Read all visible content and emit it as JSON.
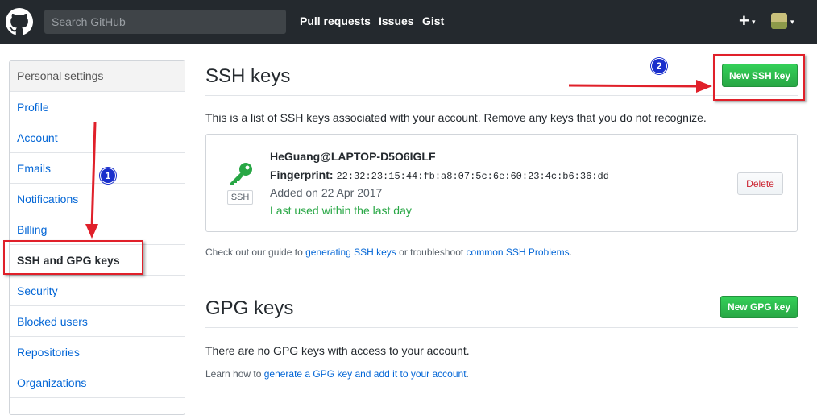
{
  "header": {
    "search_placeholder": "Search GitHub",
    "nav": [
      "Pull requests",
      "Issues",
      "Gist"
    ],
    "plus_label": "+",
    "caret": "▾"
  },
  "sidebar": {
    "heading": "Personal settings",
    "items": [
      {
        "label": "Profile"
      },
      {
        "label": "Account"
      },
      {
        "label": "Emails"
      },
      {
        "label": "Notifications"
      },
      {
        "label": "Billing"
      },
      {
        "label": "SSH and GPG keys",
        "selected": true
      },
      {
        "label": "Security"
      },
      {
        "label": "Blocked users"
      },
      {
        "label": "Repositories"
      },
      {
        "label": "Organizations"
      }
    ]
  },
  "ssh": {
    "title": "SSH keys",
    "new_button": "New SSH key",
    "description": "This is a list of SSH keys associated with your account. Remove any keys that you do not recognize.",
    "key": {
      "name": "HeGuang@LAPTOP-D5O6IGLF",
      "fingerprint_label": "Fingerprint:",
      "fingerprint": "22:32:23:15:44:fb:a8:07:5c:6e:60:23:4c:b6:36:dd",
      "added": "Added on 22 Apr 2017",
      "last_used": "Last used within the last day",
      "badge": "SSH",
      "delete_label": "Delete"
    },
    "guide": {
      "prefix": "Check out our guide to ",
      "link1": "generating SSH keys",
      "middle": " or troubleshoot ",
      "link2": "common SSH Problems",
      "suffix": "."
    }
  },
  "gpg": {
    "title": "GPG keys",
    "new_button": "New GPG key",
    "empty_text": "There are no GPG keys with access to your account.",
    "learn": {
      "prefix": "Learn how to ",
      "link": "generate a GPG key and add it to your account",
      "suffix": "."
    }
  },
  "annotations": {
    "step1": "1",
    "step2": "2",
    "arrow_color": "#e0202a"
  }
}
